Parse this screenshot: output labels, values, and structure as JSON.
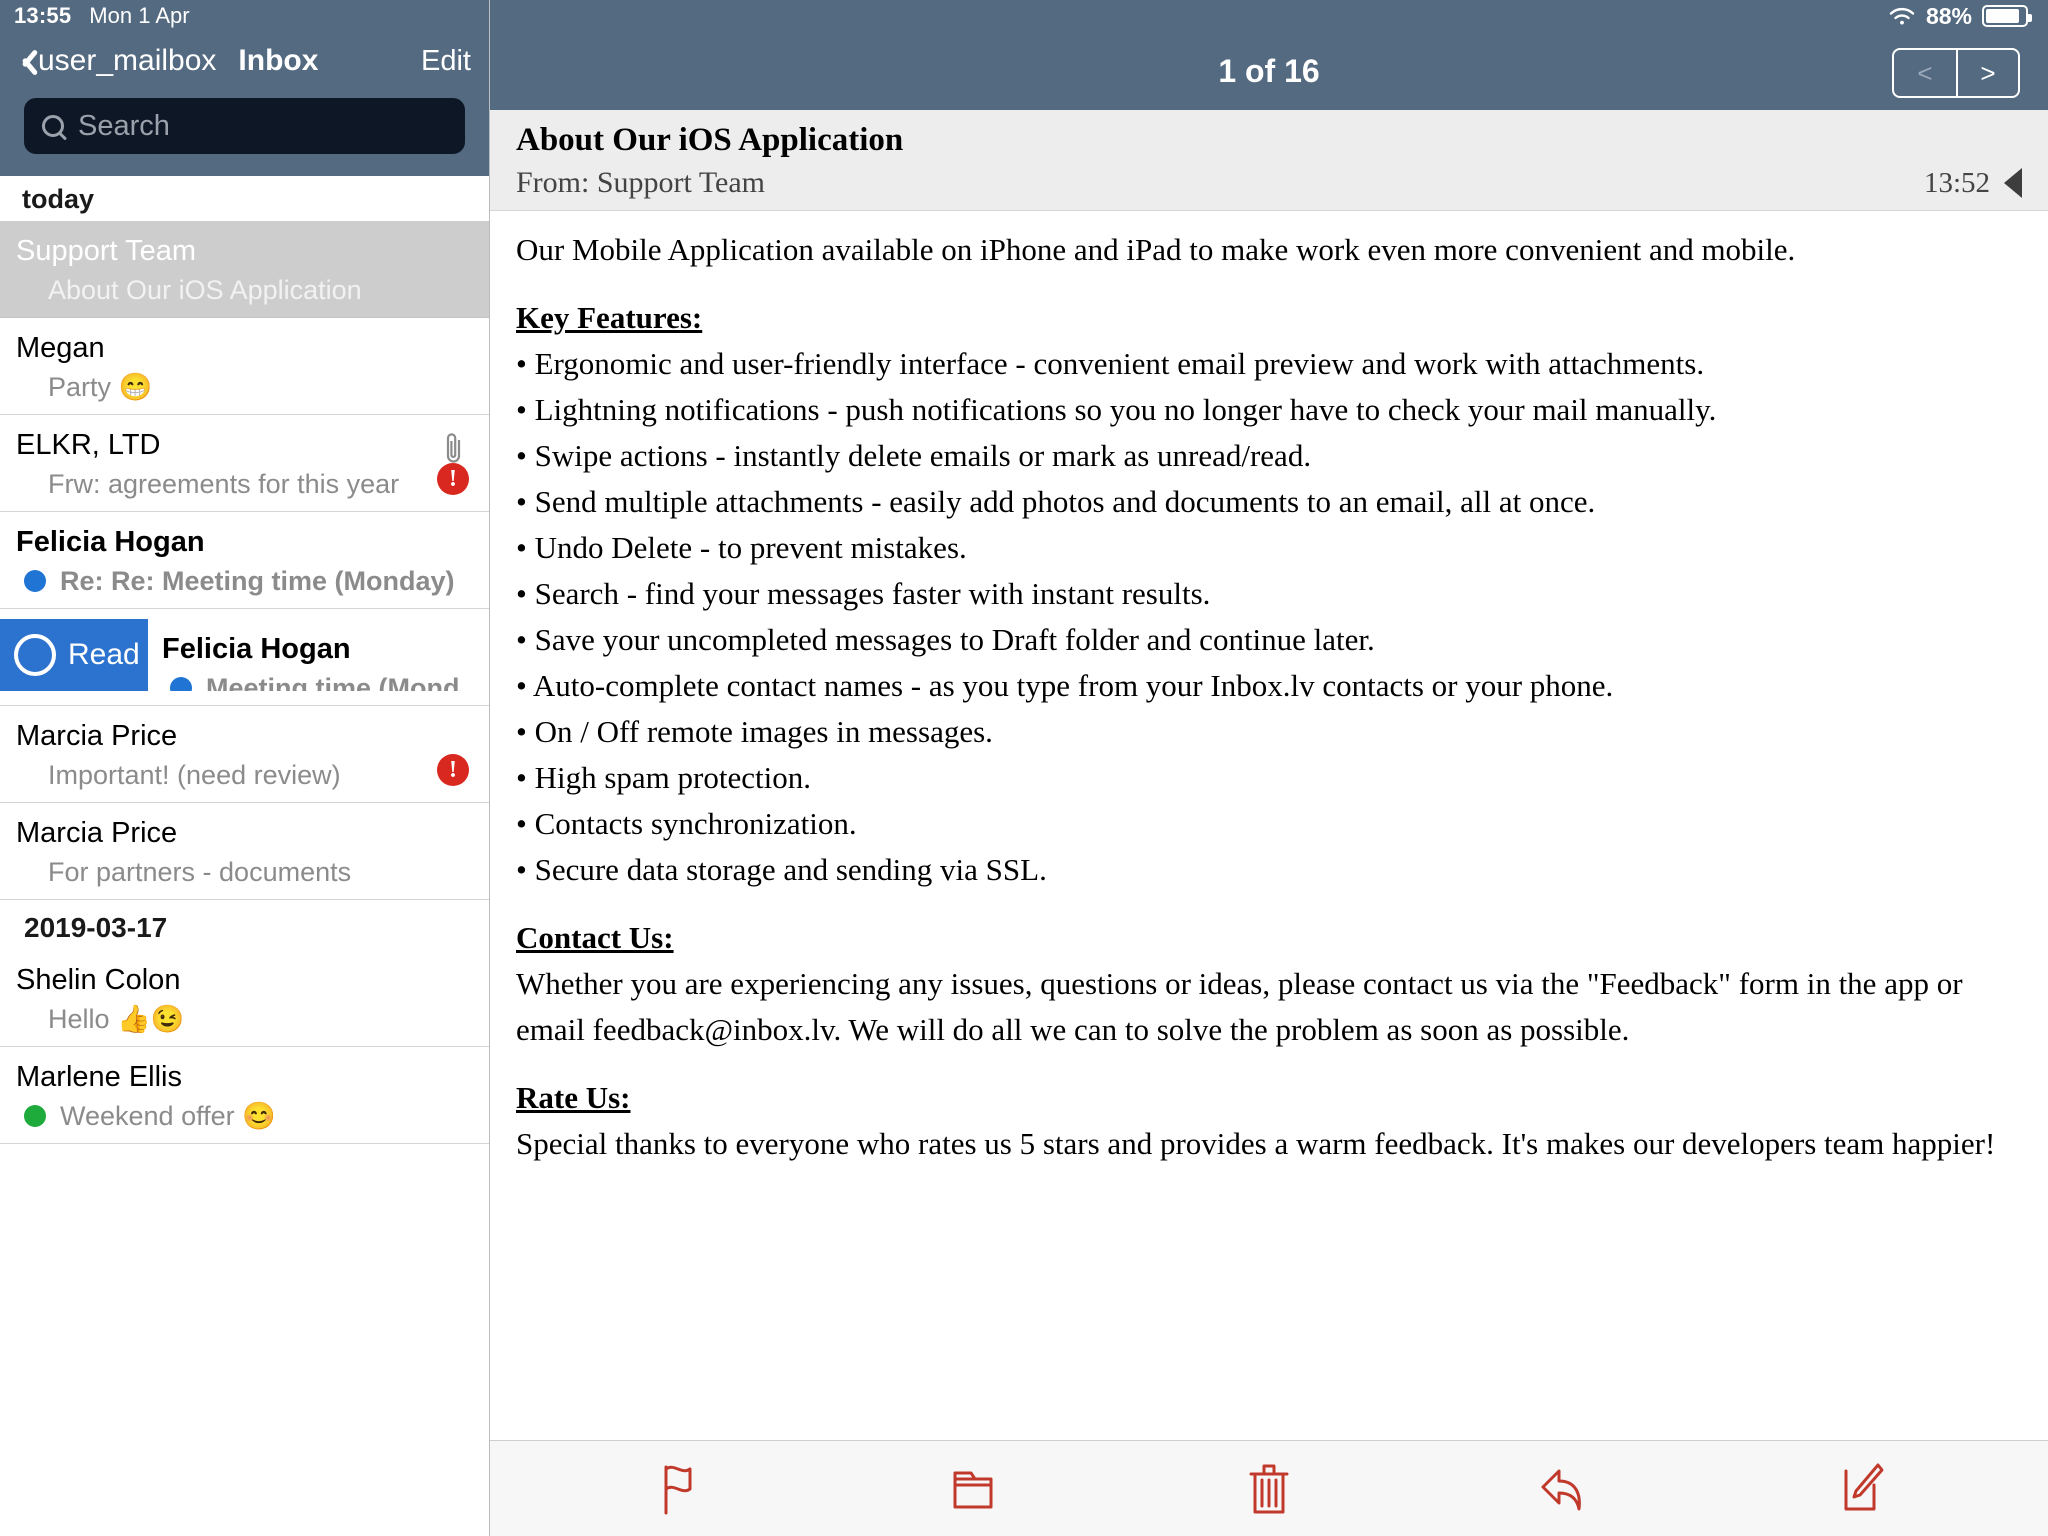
{
  "status": {
    "time": "13:55",
    "date": "Mon 1 Apr",
    "battery_percent": "88%",
    "wifi_icon": "wifi-icon",
    "battery_icon": "battery-icon"
  },
  "sidebar": {
    "back_label": "user_mailbox",
    "title": "Inbox",
    "edit_label": "Edit",
    "search": {
      "placeholder": "Search",
      "value": "",
      "icon": "search-icon"
    },
    "sections": [
      {
        "label": "today"
      },
      {
        "label": "2019-03-17"
      }
    ],
    "messages": [
      {
        "sender": "Support Team",
        "subject": "About Our iOS Application",
        "selected": true,
        "unread": false,
        "dot": "",
        "attachment": false,
        "important": false,
        "swiped": false
      },
      {
        "sender": "Megan",
        "subject": "Party 😁",
        "selected": false,
        "unread": false,
        "dot": "",
        "attachment": false,
        "important": false,
        "swiped": false
      },
      {
        "sender": "ELKR, LTD",
        "subject": "Frw: agreements for this year",
        "selected": false,
        "unread": false,
        "dot": "",
        "attachment": true,
        "important": true,
        "swiped": false
      },
      {
        "sender": "Felicia Hogan",
        "subject": "Re: Re: Meeting time (Monday)",
        "selected": false,
        "unread": true,
        "dot": "blue",
        "attachment": false,
        "important": false,
        "swiped": false
      },
      {
        "sender": "Felicia Hogan",
        "subject": "Meeting time (Monday)",
        "selected": false,
        "unread": true,
        "dot": "blue",
        "attachment": false,
        "important": false,
        "swiped": true,
        "swipe_action_label": "Read",
        "swipe_action_icon": "unread-circle-icon"
      },
      {
        "sender": "Marcia Price",
        "subject": "Important! (need review)",
        "selected": false,
        "unread": false,
        "dot": "",
        "attachment": false,
        "important": true,
        "swiped": false
      },
      {
        "sender": "Marcia Price",
        "subject": "For partners - documents",
        "selected": false,
        "unread": false,
        "dot": "",
        "attachment": false,
        "important": false,
        "swiped": false
      },
      {
        "sender": "Shelin Colon",
        "subject": "Hello 👍😉",
        "selected": false,
        "unread": false,
        "dot": "",
        "attachment": false,
        "important": false,
        "swiped": false
      },
      {
        "sender": "Marlene    Ellis",
        "subject": "Weekend offer 😊",
        "selected": false,
        "unread": false,
        "dot": "green",
        "attachment": false,
        "important": false,
        "swiped": false
      }
    ]
  },
  "detail": {
    "counter": "1 of 16",
    "prev_label": "<",
    "next_label": ">",
    "prev_disabled": true,
    "subject": "About Our iOS Application",
    "from": "From: Support Team",
    "time": "13:52",
    "collapse_icon": "triangle-left-icon",
    "body": {
      "intro": "Our Mobile Application available on iPhone and iPad to make work even more convenient and mobile.",
      "key_features_heading": "Key Features:",
      "features": [
        "• Ergonomic and user-friendly interface - convenient email preview and work with attachments.",
        "• Lightning notifications - push notifications so you no longer have to check your mail manually.",
        "• Swipe actions - instantly delete emails or mark as unread/read.",
        "• Send multiple attachments - easily add photos and documents to an email, all at once.",
        "• Undo Delete - to prevent mistakes.",
        "• Search - find your messages faster with instant results.",
        "• Save your uncompleted messages to Draft folder and continue later.",
        "• Auto-complete contact names - as you type from your Inbox.lv contacts or your phone.",
        "• On / Off remote images in messages.",
        "• High spam protection.",
        "• Contacts synchronization.",
        "• Secure data storage and sending via SSL."
      ],
      "contact_heading": "Contact Us: ",
      "contact_text": "Whether you are experiencing any issues, questions or ideas, please contact us via the \"Feedback\" form in the app or email feedback@inbox.lv. We will do all we can to solve the problem as soon as possible.",
      "rate_heading": "Rate Us:",
      "rate_text": "Special thanks to everyone who rates us 5 stars and provides a warm feedback. It's makes our developers team happier!"
    },
    "toolbar": [
      {
        "icon": "flag-icon",
        "name": "flag-button"
      },
      {
        "icon": "folder-icon",
        "name": "move-to-folder-button"
      },
      {
        "icon": "trash-icon",
        "name": "delete-button"
      },
      {
        "icon": "reply-icon",
        "name": "reply-button"
      },
      {
        "icon": "compose-icon",
        "name": "compose-button"
      }
    ],
    "accent_color": "#c0392b"
  }
}
